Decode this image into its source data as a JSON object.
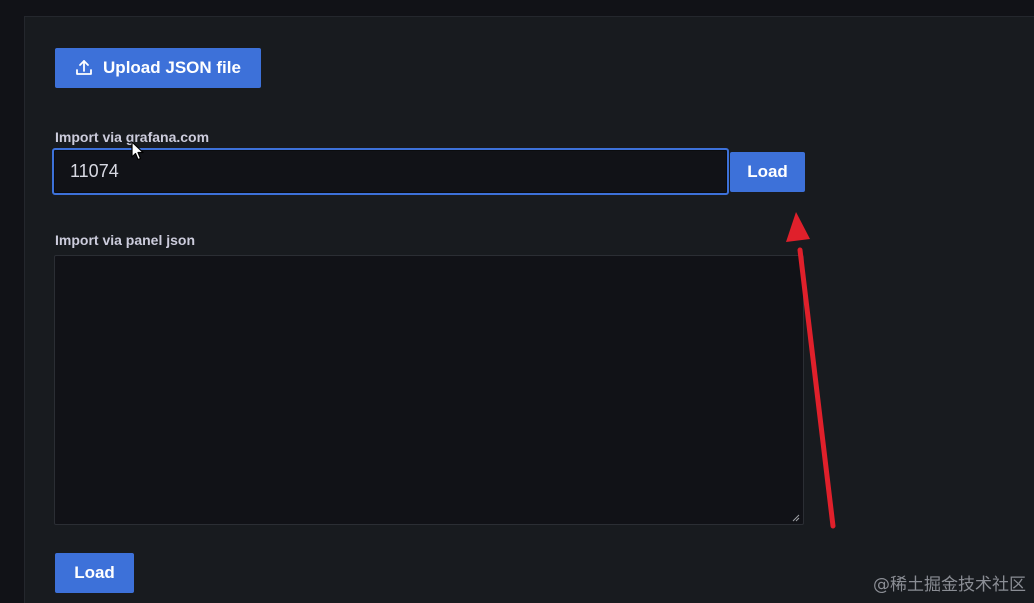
{
  "upload": {
    "label": "Upload JSON file",
    "icon": "upload-icon"
  },
  "grafana_import": {
    "label": "Import via grafana.com",
    "value": "11074",
    "button_label": "Load"
  },
  "panel_json": {
    "label": "Import via panel json",
    "value": "",
    "button_label": "Load"
  },
  "annotation": {
    "color": "#e0202b"
  },
  "watermark": "@稀土掘金技术社区",
  "colors": {
    "accent": "#3d71d9",
    "background": "#111217",
    "panel": "#181b1f"
  }
}
